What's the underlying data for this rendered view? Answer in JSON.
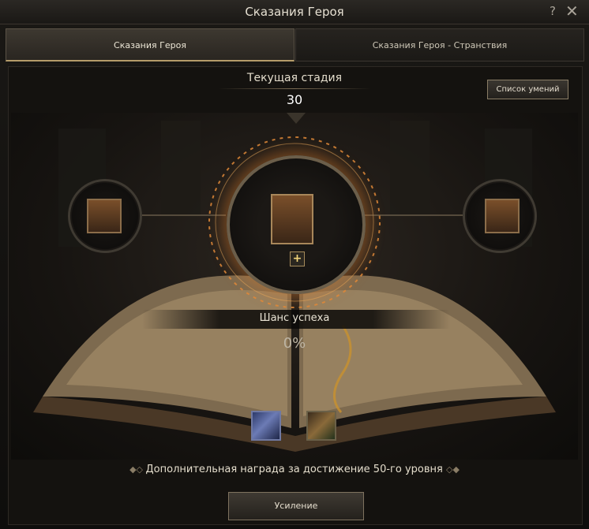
{
  "window": {
    "title": "Сказания Героя",
    "help_icon": "?",
    "close_icon": "✕"
  },
  "tabs": [
    {
      "label": "Сказания Героя",
      "active": true
    },
    {
      "label": "Сказания Героя - Странствия",
      "active": false
    }
  ],
  "stage": {
    "label": "Текущая стадия",
    "value": "30"
  },
  "skill_list_button": "Список умений",
  "success": {
    "label": "Шанс успеха",
    "value": "0%"
  },
  "plus_icon": "+",
  "rewards": [
    {
      "icon": "scroll-icon"
    },
    {
      "icon": "book-plus-icon"
    }
  ],
  "bonus_text": "Дополнительная награда за достижение 50-го уровня",
  "enhance_button": "Усиление",
  "colors": {
    "accent_gold": "#b59c6a",
    "glow_orange": "#d67828"
  }
}
